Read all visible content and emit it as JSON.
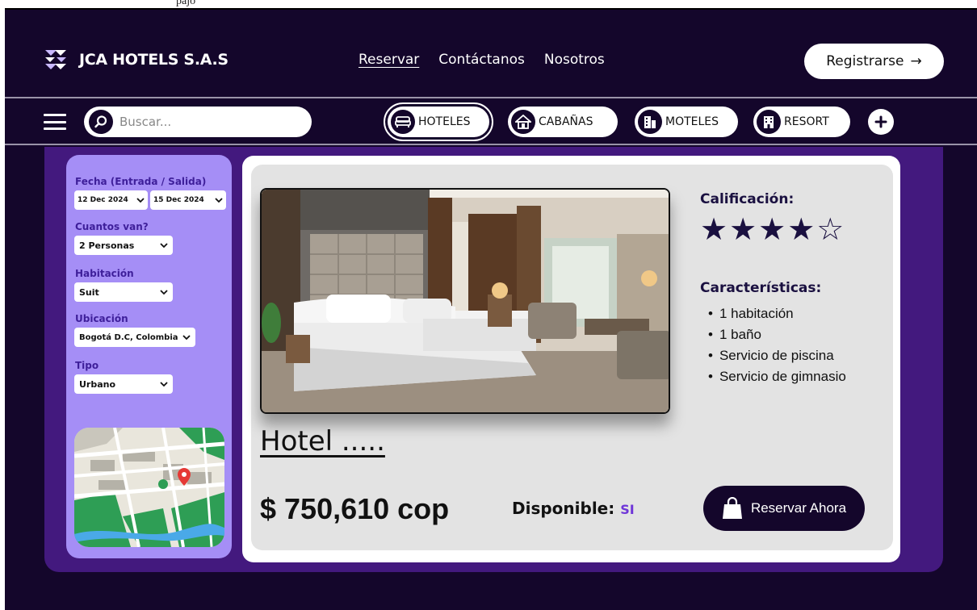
{
  "top_strip": {
    "text": "pajo"
  },
  "header": {
    "brand": "JCA HOTELS S.A.S",
    "nav": [
      {
        "label": "Reservar",
        "active": true
      },
      {
        "label": "Contáctanos",
        "active": false
      },
      {
        "label": "Nosotros",
        "active": false
      }
    ],
    "register_label": "Registrarse",
    "register_arrow": "→"
  },
  "category_bar": {
    "search_placeholder": "Buscar...",
    "categories": [
      {
        "label": "HOTELES",
        "icon": "bed-icon",
        "active": true
      },
      {
        "label": "CABAÑAS",
        "icon": "cabin-icon",
        "active": false
      },
      {
        "label": "MOTELES",
        "icon": "motel-icon",
        "active": false
      },
      {
        "label": "RESORT",
        "icon": "resort-icon",
        "active": false
      }
    ]
  },
  "filters": {
    "dates": {
      "label": "Fecha (Entrada / Salida)",
      "checkin": "12 Dec 2024",
      "checkout": "15 Dec 2024"
    },
    "guests": {
      "label": "Cuantos van?",
      "value": "2 Personas"
    },
    "room": {
      "label": "Habitación",
      "value": "Suit"
    },
    "location": {
      "label": "Ubicación",
      "value": "Bogotá D.C, Colombia"
    },
    "type": {
      "label": "Tipo",
      "value": "Urbano"
    }
  },
  "hotel": {
    "name": "Hotel .....",
    "price": "$ 750,610 cop",
    "availability_label": "Disponible:",
    "availability_value": "SI",
    "rating_label": "Calificación:",
    "rating": 4,
    "rating_max": 5,
    "rating_stars": "★★★★☆",
    "features_label": "Características:",
    "features": [
      "1 habitación",
      "1 baño",
      "Servicio de piscina",
      "Servicio de gimnasio"
    ],
    "book_label": "Reservar Ahora"
  },
  "colors": {
    "background": "#14062b",
    "panel": "#43197e",
    "filters": "#a58ef6",
    "accent_text": "#6f36d8"
  }
}
